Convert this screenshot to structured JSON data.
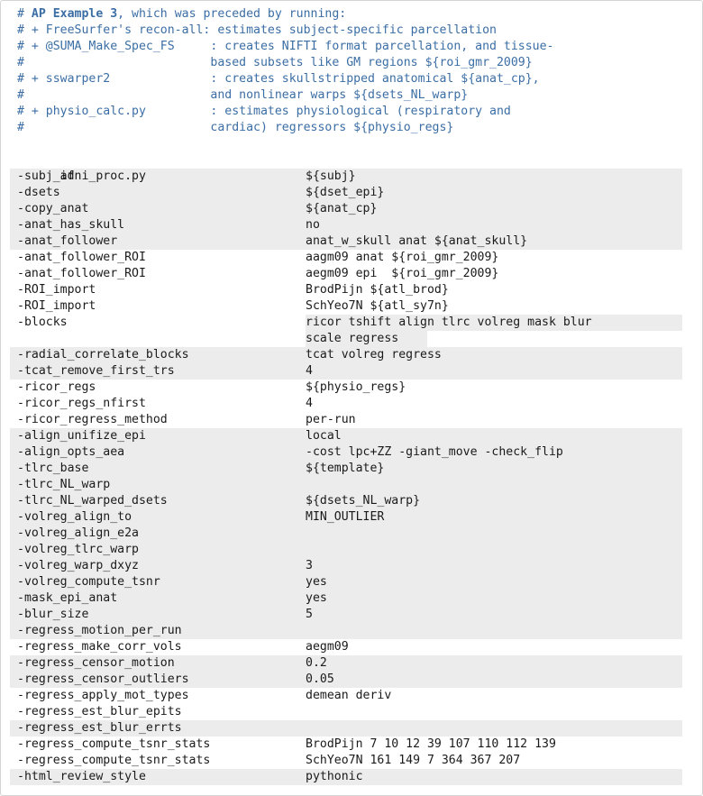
{
  "block": {
    "kind": "shell-script",
    "language": "tcsh",
    "colors": {
      "background": "#ffffff",
      "border": "#d4d4d4",
      "text": "#1a1a1a",
      "comment": "#3b6ea5",
      "highlight": "#ececec"
    },
    "continuation_char": "\\",
    "command": "afni_proc.py"
  },
  "header": {
    "lines": [
      {
        "hash": "# ",
        "bold": "AP Example 3",
        "rest": ", which was preceded by running:"
      },
      {
        "hash": "# + ",
        "bold": "",
        "rest": "FreeSurfer's recon-all: estimates subject-specific parcellation"
      },
      {
        "hash": "# + ",
        "bold": "",
        "rest": "@SUMA_Make_Spec_FS     : creates NIFTI format parcellation, and tissue-"
      },
      {
        "hash": "# ",
        "bold": "",
        "rest": "                         based subsets like GM regions ${roi_gmr_2009}"
      },
      {
        "hash": "# + ",
        "bold": "",
        "rest": "sswarper2              : creates skullstripped anatomical ${anat_cp},"
      },
      {
        "hash": "# ",
        "bold": "",
        "rest": "                         and nonlinear warps ${dsets_NL_warp}"
      },
      {
        "hash": "# + ",
        "bold": "",
        "rest": "physio_calc.py         : estimates physiological (respiratory and"
      },
      {
        "hash": "# ",
        "bold": "",
        "rest": "                         cardiac) regressors ${physio_regs}"
      }
    ]
  },
  "command_line": {
    "text": "afni_proc.py",
    "cont": "\\"
  },
  "options": [
    {
      "opt": "-subj_id",
      "val": "${subj}",
      "cont": "\\",
      "hl": "full"
    },
    {
      "opt": "-dsets",
      "val": "${dset_epi}",
      "cont": "\\",
      "hl": "full"
    },
    {
      "opt": "-copy_anat",
      "val": "${anat_cp}",
      "cont": "\\",
      "hl": "full"
    },
    {
      "opt": "-anat_has_skull",
      "val": "no",
      "cont": "\\",
      "hl": "full"
    },
    {
      "opt": "-anat_follower",
      "val": "anat_w_skull anat ${anat_skull}",
      "cont": "\\",
      "hl": "full"
    },
    {
      "opt": "-anat_follower_ROI",
      "val": "aagm09 anat ${roi_gmr_2009}",
      "cont": "\\",
      "hl": "none"
    },
    {
      "opt": "-anat_follower_ROI",
      "val": "aegm09 epi  ${roi_gmr_2009}",
      "cont": "\\",
      "hl": "none"
    },
    {
      "opt": "-ROI_import",
      "val": "BrodPijn ${atl_brod}",
      "cont": "\\",
      "hl": "none"
    },
    {
      "opt": "-ROI_import",
      "val": "SchYeo7N ${atl_sy7n}",
      "cont": "\\",
      "hl": "none"
    },
    {
      "opt": "-blocks",
      "val": "ricor tshift align tlrc volreg mask blur",
      "cont": "\\",
      "hl": "value"
    },
    {
      "opt": "",
      "val": "scale regress",
      "cont": "\\",
      "hl": "valshort"
    },
    {
      "opt": "-radial_correlate_blocks",
      "val": "tcat volreg regress",
      "cont": "\\",
      "hl": "full"
    },
    {
      "opt": "-tcat_remove_first_trs",
      "val": "4",
      "cont": "\\",
      "hl": "full"
    },
    {
      "opt": "-ricor_regs",
      "val": "${physio_regs}",
      "cont": "\\",
      "hl": "none"
    },
    {
      "opt": "-ricor_regs_nfirst",
      "val": "4",
      "cont": "\\",
      "hl": "none"
    },
    {
      "opt": "-ricor_regress_method",
      "val": "per-run",
      "cont": "\\",
      "hl": "none"
    },
    {
      "opt": "-align_unifize_epi",
      "val": "local",
      "cont": "\\",
      "hl": "full"
    },
    {
      "opt": "-align_opts_aea",
      "val": "-cost lpc+ZZ -giant_move -check_flip",
      "cont": "\\",
      "hl": "full"
    },
    {
      "opt": "-tlrc_base",
      "val": "${template}",
      "cont": "\\",
      "hl": "full"
    },
    {
      "opt": "-tlrc_NL_warp",
      "val": "",
      "cont": "\\",
      "hl": "full"
    },
    {
      "opt": "-tlrc_NL_warped_dsets",
      "val": "${dsets_NL_warp}",
      "cont": "\\",
      "hl": "full"
    },
    {
      "opt": "-volreg_align_to",
      "val": "MIN_OUTLIER",
      "cont": "\\",
      "hl": "full"
    },
    {
      "opt": "-volreg_align_e2a",
      "val": "",
      "cont": "\\",
      "hl": "full"
    },
    {
      "opt": "-volreg_tlrc_warp",
      "val": "",
      "cont": "\\",
      "hl": "full"
    },
    {
      "opt": "-volreg_warp_dxyz",
      "val": "3",
      "cont": "\\",
      "hl": "full"
    },
    {
      "opt": "-volreg_compute_tsnr",
      "val": "yes",
      "cont": "\\",
      "hl": "full"
    },
    {
      "opt": "-mask_epi_anat",
      "val": "yes",
      "cont": "\\",
      "hl": "full"
    },
    {
      "opt": "-blur_size",
      "val": "5",
      "cont": "\\",
      "hl": "full"
    },
    {
      "opt": "-regress_motion_per_run",
      "val": "",
      "cont": "\\",
      "hl": "full"
    },
    {
      "opt": "-regress_make_corr_vols",
      "val": "aegm09",
      "cont": "\\",
      "hl": "none"
    },
    {
      "opt": "-regress_censor_motion",
      "val": "0.2",
      "cont": "\\",
      "hl": "full"
    },
    {
      "opt": "-regress_censor_outliers",
      "val": "0.05",
      "cont": "\\",
      "hl": "full"
    },
    {
      "opt": "-regress_apply_mot_types",
      "val": "demean deriv",
      "cont": "\\",
      "hl": "none"
    },
    {
      "opt": "-regress_est_blur_epits",
      "val": "",
      "cont": "\\",
      "hl": "none"
    },
    {
      "opt": "-regress_est_blur_errts",
      "val": "",
      "cont": "\\",
      "hl": "full"
    },
    {
      "opt": "-regress_compute_tsnr_stats",
      "val": "BrodPijn 7 10 12 39 107 110 112 139",
      "cont": "\\",
      "hl": "none"
    },
    {
      "opt": "-regress_compute_tsnr_stats",
      "val": "SchYeo7N 161 149 7 364 367 207",
      "cont": "\\",
      "hl": "none"
    },
    {
      "opt": "-html_review_style",
      "val": "pythonic",
      "cont": "",
      "hl": "full"
    }
  ]
}
